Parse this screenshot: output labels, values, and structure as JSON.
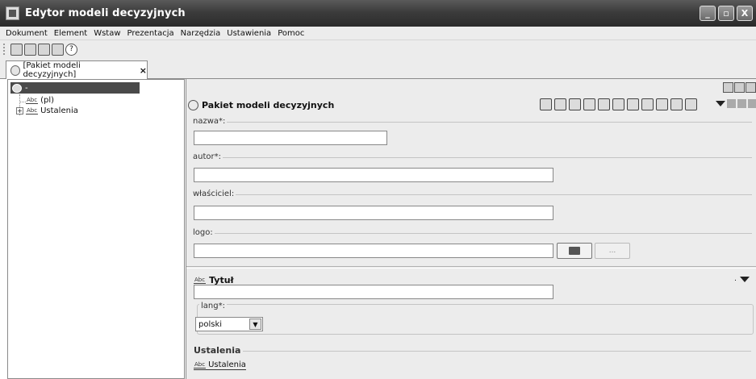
{
  "window": {
    "title": "Edytor modeli decyzyjnych",
    "controls": [
      "_",
      "▫",
      "X"
    ]
  },
  "menu": [
    "Dokument",
    "Element",
    "Wstaw",
    "Prezentacja",
    "Narzędzia",
    "Ustawienia",
    "Pomoc"
  ],
  "tab": {
    "label": "[Pakiet modeli decyzyjnych]",
    "close": "×"
  },
  "tree": {
    "root_label": "-",
    "items": [
      {
        "label": "(pl)",
        "icon": "abc-icon"
      },
      {
        "label": "Ustalenia",
        "icon": "abc-list-icon",
        "expander": "+"
      }
    ]
  },
  "panel": {
    "title": "Pakiet modeli decyzyjnych",
    "fields": {
      "nazwa": {
        "label": "nazwa*:",
        "value": ""
      },
      "autor": {
        "label": "autor*:",
        "value": ""
      },
      "wlasciciel": {
        "label": "właściciel:",
        "value": ""
      },
      "logo": {
        "label": "logo:",
        "value": "",
        "more": "..."
      }
    },
    "tytul": {
      "title": "Tytuł",
      "value": "",
      "lang_label": "lang*:",
      "lang_value": "polski",
      "collapse_mark": "."
    },
    "ustalenia": {
      "title": "Ustalenia",
      "link": "Ustalenia"
    }
  }
}
